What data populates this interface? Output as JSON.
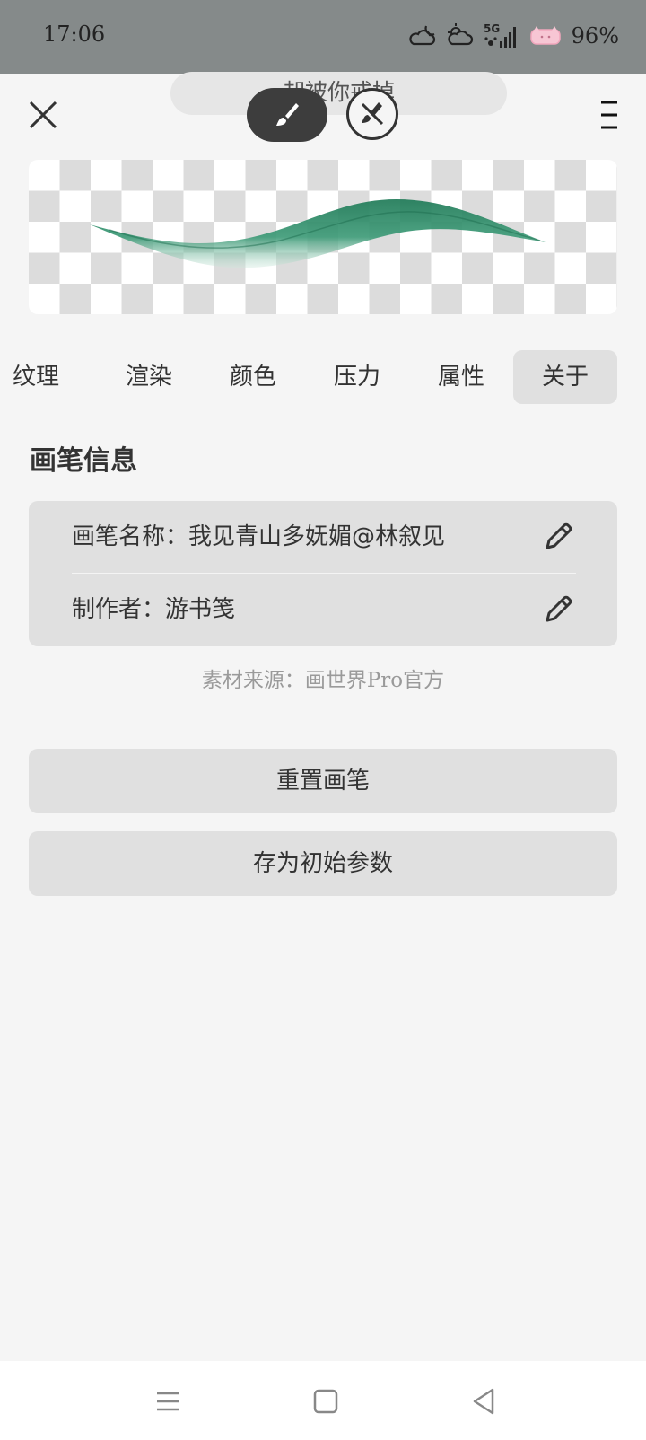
{
  "status_bar": {
    "time": "17:06",
    "network": "5G",
    "battery": "96%",
    "icons": [
      "cloudy-night-icon",
      "cloudy-icon",
      "signal-icon",
      "wifi-icon",
      "battery-icon"
    ]
  },
  "toolbar": {
    "toast_text": "却被你戒掉",
    "close_icon": "close-icon",
    "menu_icon": "menu-icon",
    "brush_icon": "brush-icon",
    "eraser_icon": "eraser-icon"
  },
  "preview": {
    "stroke_color": "#2e8b6a"
  },
  "tabs": [
    {
      "label": "纹理",
      "active": false
    },
    {
      "label": "渲染",
      "active": false
    },
    {
      "label": "颜色",
      "active": false
    },
    {
      "label": "压力",
      "active": false
    },
    {
      "label": "属性",
      "active": false
    },
    {
      "label": "关于",
      "active": true
    }
  ],
  "section": {
    "title": "画笔信息"
  },
  "info": {
    "brush_name": "画笔名称：我见青山多妩媚@林叙见",
    "author": "制作者：游书笺",
    "source": "素材来源：画世界Pro官方"
  },
  "buttons": {
    "reset": "重置画笔",
    "save_default": "存为初始参数"
  },
  "navbar": {
    "icons": [
      "recent-apps-icon",
      "home-icon",
      "back-icon"
    ]
  }
}
